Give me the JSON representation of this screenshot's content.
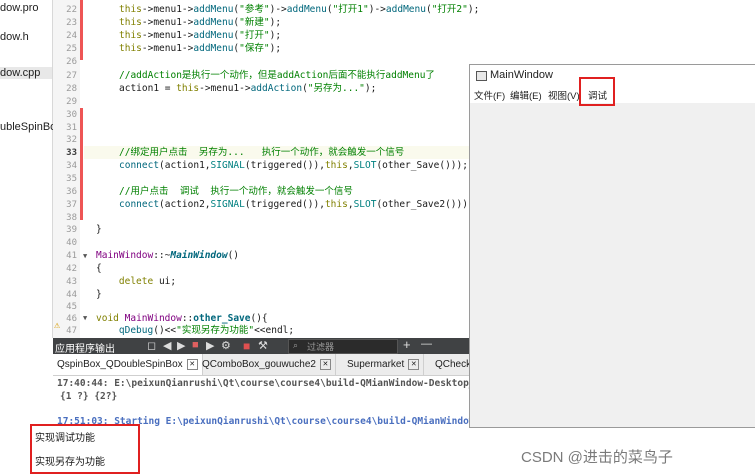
{
  "files": [
    "dow.pro",
    "dow.h",
    "dow.cpp",
    "ubleSpinBox"
  ],
  "code": {
    "line_numbers": [
      "22",
      "23",
      "24",
      "25",
      "26",
      "27",
      "28",
      "29",
      "30",
      "31",
      "32",
      "33",
      "34",
      "35",
      "36",
      "37",
      "38",
      "39",
      "40",
      "41",
      "42",
      "43",
      "44",
      "45",
      "46",
      "47"
    ],
    "lines": [
      "this->menu1->addMenu(\"参考\")->addMenu(\"打开1\")->addMenu(\"打开2\");",
      "this->menu1->addMenu(\"新建\");",
      "this->menu1->addMenu(\"打开\");",
      "this->menu1->addMenu(\"保存\");",
      "",
      "//addAction是执行一个动作，但是addAction后面不能执行addMenu了",
      "action1 = this->menu1->addAction(\"另存为...\");",
      "",
      "",
      "",
      "",
      "//绑定用户点击  另存为...   执行一个动作，就会触发一个信号",
      "connect(action1,SIGNAL(triggered()),this,SLOT(other_Save()));",
      "",
      "//用户点击  调试  执行一个动作，就会触发一个信号",
      "connect(action2,SIGNAL(triggered()),this,SLOT(other_Save2()));",
      "",
      "}",
      "",
      "MainWindow::~MainWindow()",
      "{",
      "    delete ui;",
      "}",
      "",
      "void MainWindow::other_Save(){",
      "    qDebug()<<\"实现另存为功能\"<<endl;"
    ]
  },
  "output": {
    "panel_label": "应用程序输出",
    "filter_placeholder": "过滤器",
    "plus": "+",
    "minus": "—",
    "tabs": [
      "QspinBox_QDoubleSpinBox",
      "QComboBox_gouwuche2",
      "Supermarket",
      "QCheckB"
    ],
    "lines": [
      "17:40:44: E:\\peixunQianrushi\\Qt\\course\\course4\\build-QMianWindow-Desktop_Q",
      "{1 ?} {2?}",
      "",
      "17:51:03: Starting E:\\peixunQianrushi\\Qt\\course\\course4\\build-QMianWindow-",
      "实现调试功能",
      "",
      "实现另存为功能"
    ]
  },
  "main_window": {
    "title": "MainWindow",
    "menus": [
      "文件(F)",
      "编辑(E)",
      "视图(V)",
      "调试"
    ]
  },
  "watermark": "CSDN @进击的菜鸟子",
  "colors": {
    "highlight_box": "#e02020",
    "output_toolbar": "#404244"
  }
}
